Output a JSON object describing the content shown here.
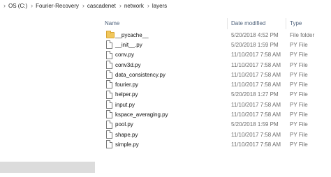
{
  "breadcrumb": {
    "items": [
      "OS (C:)",
      "Fourier-Recovery",
      "cascadenet",
      "network",
      "layers"
    ]
  },
  "columns": {
    "name": "Name",
    "date": "Date modified",
    "type": "Type"
  },
  "files": [
    {
      "name": "__pycache__",
      "date": "5/20/2018 4:52 PM",
      "type": "File folder",
      "icon": "folder-icon"
    },
    {
      "name": "__init__.py",
      "date": "5/20/2018 1:59 PM",
      "type": "PY File",
      "icon": "python-file-icon"
    },
    {
      "name": "conv.py",
      "date": "11/10/2017 7:58 AM",
      "type": "PY File",
      "icon": "python-file-icon"
    },
    {
      "name": "conv3d.py",
      "date": "11/10/2017 7:58 AM",
      "type": "PY File",
      "icon": "python-file-icon"
    },
    {
      "name": "data_consistency.py",
      "date": "11/10/2017 7:58 AM",
      "type": "PY File",
      "icon": "python-file-icon"
    },
    {
      "name": "fourier.py",
      "date": "11/10/2017 7:58 AM",
      "type": "PY File",
      "icon": "python-file-icon"
    },
    {
      "name": "helper.py",
      "date": "5/20/2018 1:27 PM",
      "type": "PY File",
      "icon": "python-file-icon"
    },
    {
      "name": "input.py",
      "date": "11/10/2017 7:58 AM",
      "type": "PY File",
      "icon": "python-file-icon"
    },
    {
      "name": "kspace_averaging.py",
      "date": "11/10/2017 7:58 AM",
      "type": "PY File",
      "icon": "python-file-icon"
    },
    {
      "name": "pool.py",
      "date": "5/20/2018 1:59 PM",
      "type": "PY File",
      "icon": "python-file-icon"
    },
    {
      "name": "shape.py",
      "date": "11/10/2017 7:58 AM",
      "type": "PY File",
      "icon": "python-file-icon"
    },
    {
      "name": "simple.py",
      "date": "11/10/2017 7:58 AM",
      "type": "PY File",
      "icon": "python-file-icon"
    }
  ],
  "icons": {
    "breadcrumb_separator": "chevron-right-icon",
    "folder": "folder-icon",
    "file": "python-file-icon"
  },
  "colors": {
    "header_text": "#4c607a",
    "meta_text": "#6d6d6d",
    "folder_fill": "#f1c75c"
  }
}
